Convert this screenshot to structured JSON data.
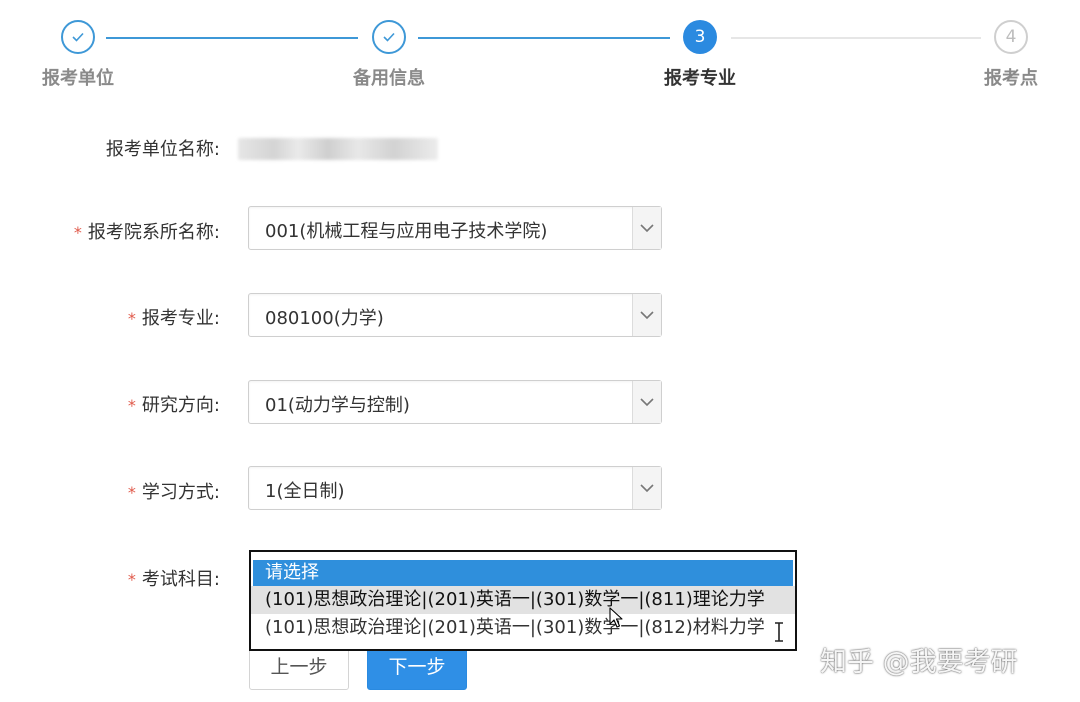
{
  "stepper": {
    "steps": [
      {
        "index": "1",
        "label": "报考单位",
        "state": "done",
        "icon": "check-icon"
      },
      {
        "index": "2",
        "label": "备用信息",
        "state": "done",
        "icon": "check-icon"
      },
      {
        "index": "3",
        "label": "报考专业",
        "state": "active"
      },
      {
        "index": "4",
        "label": "报考点",
        "state": "todo"
      }
    ]
  },
  "form": {
    "unit_name": {
      "label": "报考单位名称:",
      "value_blurred": true
    },
    "department": {
      "label": "报考院系所名称:",
      "required_mark": "*",
      "value": "001(机械工程与应用电子技术学院)"
    },
    "major": {
      "label": "报考专业:",
      "required_mark": "*",
      "value": "080100(力学)"
    },
    "direction": {
      "label": "研究方向:",
      "required_mark": "*",
      "value": "01(动力学与控制)"
    },
    "study_mode": {
      "label": "学习方式:",
      "required_mark": "*",
      "value": "1(全日制)"
    },
    "exam_subjects": {
      "label": "考试科目:",
      "required_mark": "*",
      "options": [
        "请选择",
        "(101)思想政治理论|(201)英语一|(301)数学一|(811)理论力学",
        "(101)思想政治理论|(201)英语一|(301)数学一|(812)材料力学"
      ],
      "highlighted_index": 0,
      "hovered_index": 1
    }
  },
  "buttons": {
    "prev": "上一步",
    "next": "下一步"
  },
  "watermark": "知乎 @我要考研",
  "colors": {
    "primary": "#2f8fe6",
    "step_done": "#3e98d7",
    "required": "#e05a4b",
    "listbox_border": "#111111"
  }
}
